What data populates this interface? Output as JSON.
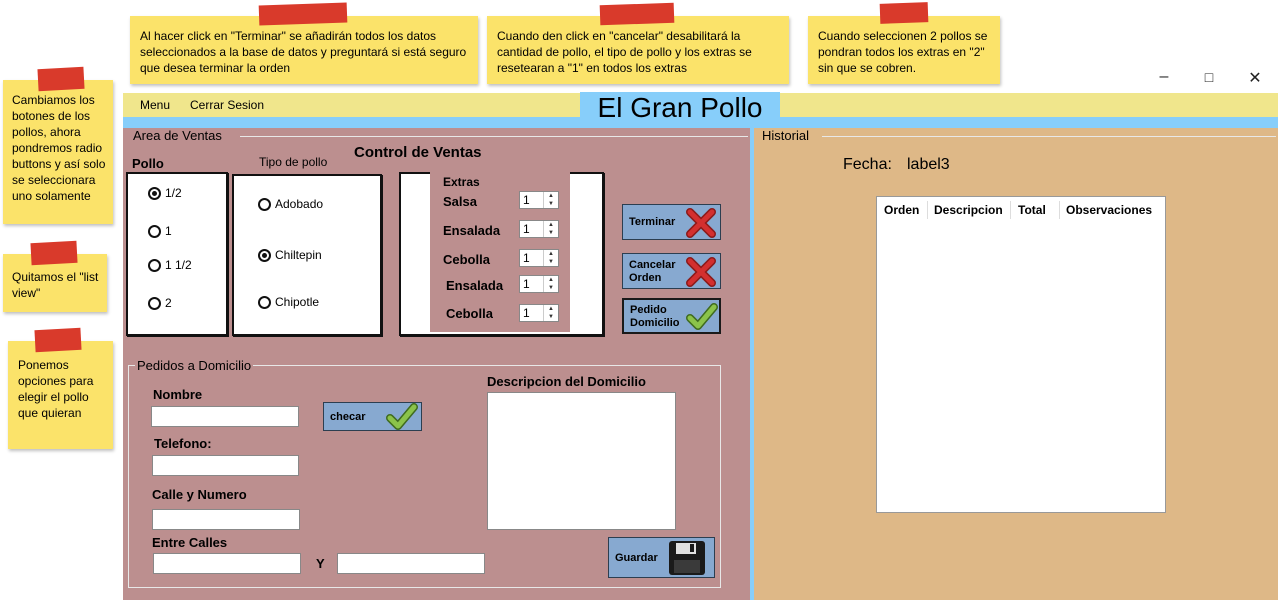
{
  "window": {
    "minimize_icon": "minimize-icon",
    "maximize_icon": "maximize-icon",
    "close_icon": "close-icon"
  },
  "menu": {
    "items": [
      "Menu",
      "Cerrar Sesion"
    ]
  },
  "app": {
    "brand": "El Gran Pollo"
  },
  "ventas": {
    "group_label": "Area de Ventas",
    "title": "Control de Ventas",
    "pollo_label": "Pollo",
    "pollo_options": [
      "1/2",
      "1",
      "1 1/2",
      "2"
    ],
    "pollo_selected": "1/2",
    "tipo_label": "Tipo de pollo",
    "tipo_options": [
      "Adobado",
      "Chiltepin",
      "Chipotle"
    ],
    "tipo_selected": "Chiltepin",
    "extras_label": "Extras",
    "extras": [
      {
        "label": "Salsa",
        "value": "1"
      },
      {
        "label": "Ensalada",
        "value": "1"
      },
      {
        "label": "Cebolla",
        "value": "1"
      },
      {
        "label": "Ensalada",
        "value": "1"
      },
      {
        "label": "Cebolla",
        "value": "1"
      }
    ],
    "buttons": {
      "terminar": "Terminar",
      "cancelar_line1": "Cancelar",
      "cancelar_line2": "Orden",
      "pedido_line1": "Pedido",
      "pedido_line2": "Domicilio"
    }
  },
  "domicilio": {
    "group_label": "Pedidos a Domicilio",
    "nombre_label": "Nombre",
    "telefono_label": "Telefono:",
    "calle_label": "Calle y Numero",
    "entre_label": "Entre Calles",
    "y_label": "Y",
    "descripcion_label": "Descripcion del Domicilio",
    "checar_button": "checar",
    "guardar_button": "Guardar",
    "values": {
      "nombre": "",
      "telefono": "",
      "calle": "",
      "entre1": "",
      "entre2": "",
      "descripcion": ""
    }
  },
  "historial": {
    "group_label": "Historial",
    "fecha_label": "Fecha:",
    "fecha_value": "label3",
    "columns": [
      "Orden",
      "Descripcion",
      "Total",
      "Observaciones"
    ]
  },
  "notes": {
    "top1": "Al hacer click en \"Terminar\" se añadirán todos los datos seleccionados a la base de datos y preguntará si está seguro que desea terminar la orden",
    "top2": "Cuando den click en \"cancelar\" desabilitará la cantidad de pollo, el tipo de pollo y los extras se resetearan a \"1\" en todos los extras",
    "top3": "Cuando seleccionen 2 pollos se pondran todos los extras en \"2\" sin que se cobren.",
    "left1": "Cambiamos los botones de los pollos, ahora pondremos radio buttons y así solo se seleccionara uno solamente",
    "left2": "Quitamos el \"list view\"",
    "left3": "Ponemos opciones para elegir el pollo que quieran"
  },
  "colors": {
    "menu_bar": "#f0e68c",
    "brand_bg": "#87cefa",
    "left_panel": "#bc8f8f",
    "right_panel": "#deb887",
    "button_bg": "#87a9d0",
    "note_bg": "#fbe36a",
    "tape": "#d93a2b",
    "cross": "#c62828",
    "check": "#7cb342"
  }
}
